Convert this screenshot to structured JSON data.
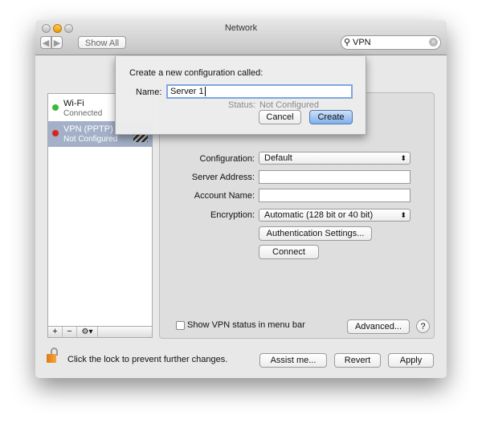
{
  "window": {
    "title": "Network"
  },
  "toolbar": {
    "show_all": "Show All",
    "search_value": "VPN"
  },
  "sidebar": {
    "items": [
      {
        "name": "Wi-Fi",
        "status": "Connected",
        "color": "#3cb93c"
      },
      {
        "name": "VPN (PPTP)",
        "status": "Not Configured",
        "color": "#d9241e"
      }
    ],
    "add": "+",
    "remove": "−",
    "gear": "⚙▾"
  },
  "panel": {
    "status_label": "Status:",
    "status_value": "Not Configured",
    "configuration_label": "Configuration:",
    "configuration_value": "Default",
    "server_label": "Server Address:",
    "server_value": "",
    "account_label": "Account Name:",
    "account_value": "",
    "encryption_label": "Encryption:",
    "encryption_value": "Automatic (128 bit or 40 bit)",
    "auth_button": "Authentication Settings...",
    "connect_button": "Connect",
    "show_status": "Show VPN status in menu bar",
    "advanced": "Advanced...",
    "help": "?"
  },
  "footer": {
    "lock_text": "Click the lock to prevent further changes.",
    "assist": "Assist me...",
    "revert": "Revert",
    "apply": "Apply"
  },
  "sheet": {
    "prompt": "Create a new configuration called:",
    "name_label": "Name:",
    "name_value": "Server 1",
    "cancel": "Cancel",
    "create": "Create"
  }
}
